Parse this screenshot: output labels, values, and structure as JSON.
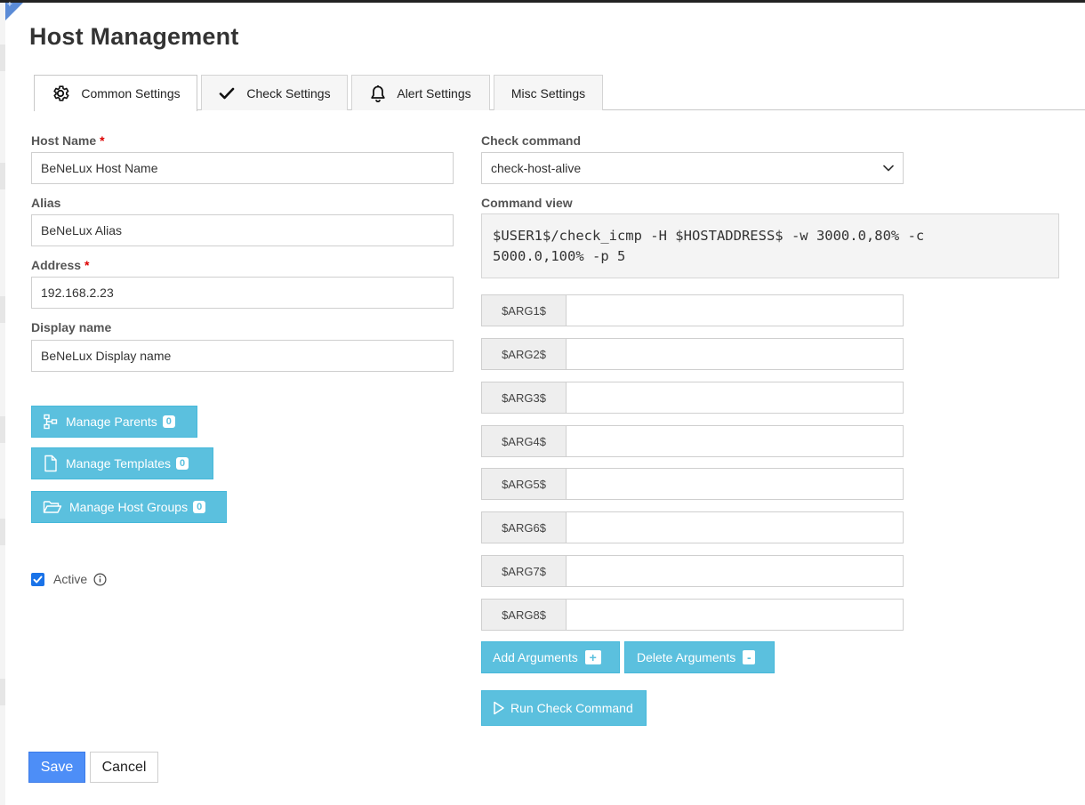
{
  "header": {
    "title": "Host Management"
  },
  "tabs": [
    {
      "label": "Common Settings",
      "icon": "gear-icon",
      "active": true
    },
    {
      "label": "Check Settings",
      "icon": "checkmark-icon"
    },
    {
      "label": "Alert Settings",
      "icon": "bell-icon"
    },
    {
      "label": "Misc Settings"
    }
  ],
  "form": {
    "host_name": {
      "label": "Host Name",
      "required_mark": "*",
      "value": "BeNeLux Host Name"
    },
    "alias": {
      "label": "Alias",
      "value": "BeNeLux Alias"
    },
    "address": {
      "label": "Address",
      "required_mark": "*",
      "value": "192.168.2.23"
    },
    "display_name": {
      "label": "Display name",
      "value": "BeNeLux Display name"
    }
  },
  "buttons": {
    "manage_parents": {
      "label": "Manage Parents",
      "count": "0"
    },
    "manage_templates": {
      "label": "Manage Templates",
      "count": "0"
    },
    "manage_host_groups": {
      "label": "Manage Host Groups",
      "count": "0"
    },
    "add_arguments": {
      "label": "Add Arguments",
      "badge": "+"
    },
    "delete_arguments": {
      "label": "Delete Arguments",
      "badge": "-"
    },
    "run_check": {
      "label": "Run Check Command"
    },
    "save": "Save",
    "cancel": "Cancel"
  },
  "active": {
    "label": "Active",
    "checked": true
  },
  "check": {
    "command_label": "Check command",
    "command_value": "check-host-alive",
    "view_label": "Command view",
    "view_line1": "$USER1$/check_icmp -H $HOSTADDRESS$ -w 3000.0,80% -c",
    "view_line2": "5000.0,100% -p 5"
  },
  "args": [
    "$ARG1$",
    "$ARG2$",
    "$ARG3$",
    "$ARG4$",
    "$ARG5$",
    "$ARG6$",
    "$ARG7$",
    "$ARG8$"
  ],
  "colors": {
    "info": "#5bc0de",
    "primary": "#4d8ef7",
    "required": "#dd0000"
  }
}
